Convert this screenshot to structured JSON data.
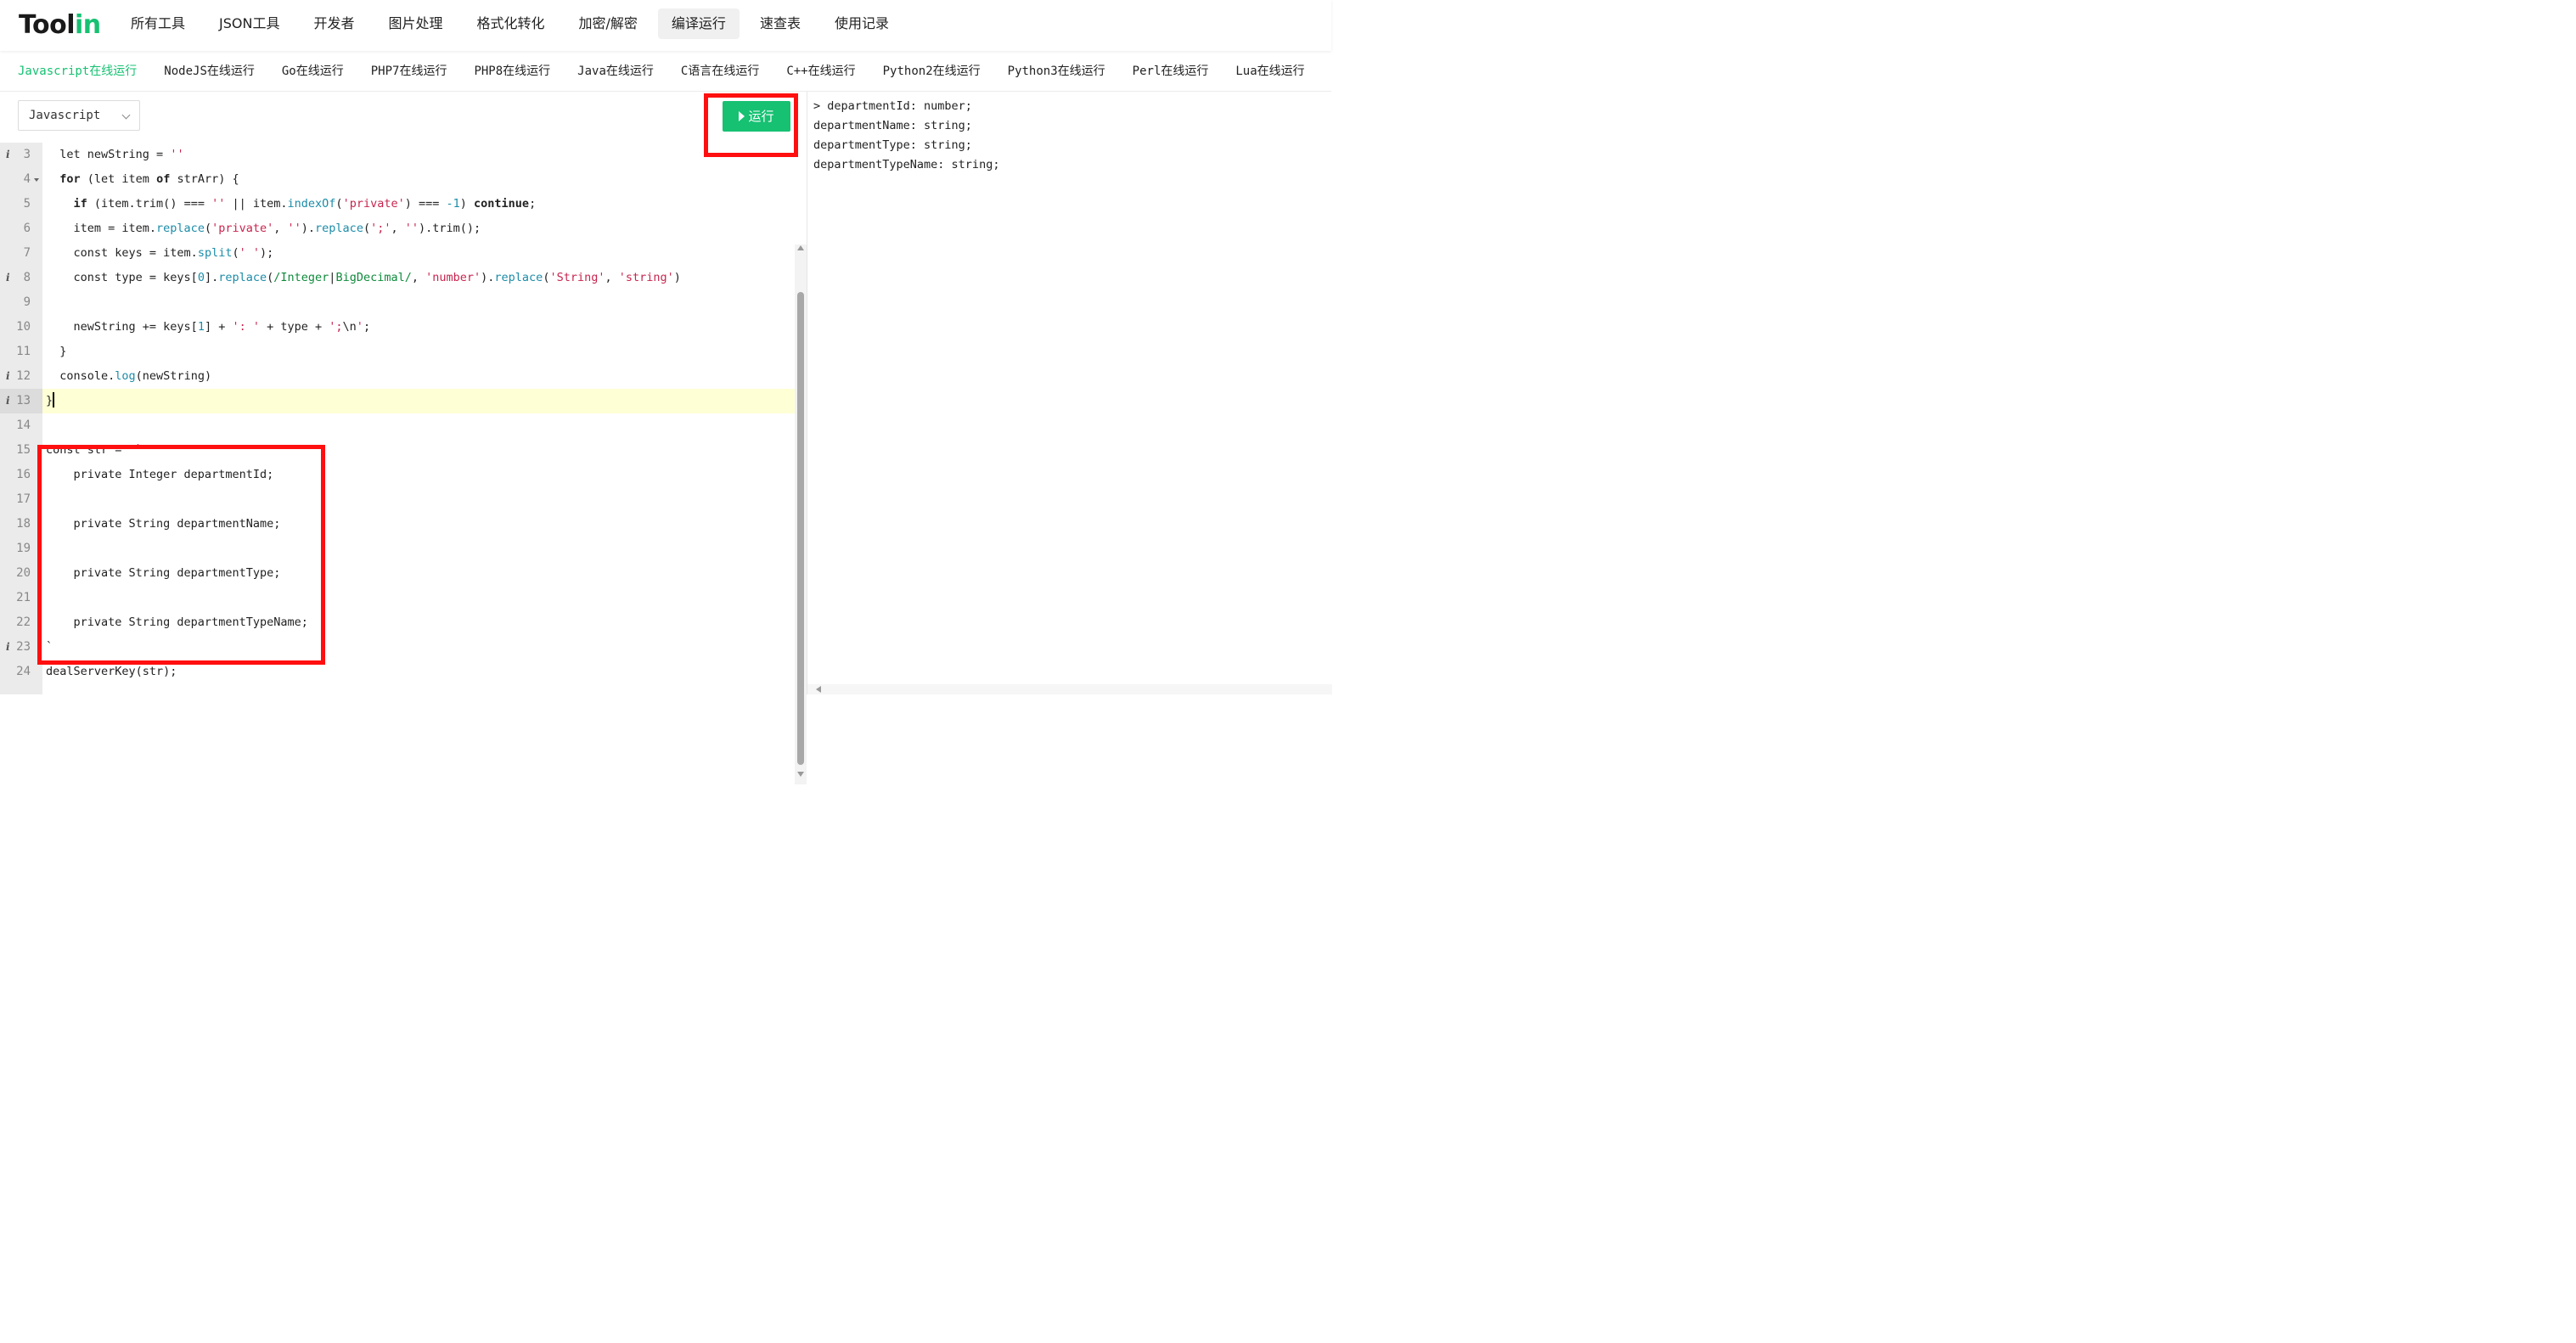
{
  "app": {
    "logo_main": "Tool",
    "logo_accent": "in",
    "accent_color": "#16c172"
  },
  "nav": {
    "items": [
      {
        "label": "所有工具"
      },
      {
        "label": "JSON工具"
      },
      {
        "label": "开发者"
      },
      {
        "label": "图片处理"
      },
      {
        "label": "格式化转化"
      },
      {
        "label": "加密/解密"
      },
      {
        "label": "编译运行",
        "active": true
      },
      {
        "label": "速查表"
      },
      {
        "label": "使用记录"
      }
    ]
  },
  "tabs": {
    "items": [
      {
        "label": "Javascript在线运行",
        "active": true
      },
      {
        "label": "NodeJS在线运行"
      },
      {
        "label": "Go在线运行"
      },
      {
        "label": "PHP7在线运行"
      },
      {
        "label": "PHP8在线运行"
      },
      {
        "label": "Java在线运行"
      },
      {
        "label": "C语言在线运行"
      },
      {
        "label": "C++在线运行"
      },
      {
        "label": "Python2在线运行"
      },
      {
        "label": "Python3在线运行"
      },
      {
        "label": "Perl在线运行"
      },
      {
        "label": "Lua在线运行"
      }
    ]
  },
  "editor": {
    "language_selected": "Javascript",
    "run_label": "运行",
    "lines": [
      {
        "n": "3",
        "info": true
      },
      {
        "n": "4",
        "fold": true
      },
      {
        "n": "5"
      },
      {
        "n": "6"
      },
      {
        "n": "7"
      },
      {
        "n": "8",
        "info": true
      },
      {
        "n": "9"
      },
      {
        "n": "10"
      },
      {
        "n": "11"
      },
      {
        "n": "12",
        "info": true
      },
      {
        "n": "13",
        "info": true,
        "current": true
      },
      {
        "n": "14"
      },
      {
        "n": "15"
      },
      {
        "n": "16"
      },
      {
        "n": "17"
      },
      {
        "n": "18"
      },
      {
        "n": "19"
      },
      {
        "n": "20"
      },
      {
        "n": "21"
      },
      {
        "n": "22"
      },
      {
        "n": "23",
        "info": true
      },
      {
        "n": "24"
      }
    ],
    "code": {
      "l3_a": "  let newString = ",
      "l3_b": "''",
      "l4_a": "  ",
      "l4_for": "for",
      "l4_b": " (let item ",
      "l4_of": "of",
      "l4_c": " strArr) {",
      "l5_a": "    ",
      "l5_if": "if",
      "l5_b": " (item.trim() === ",
      "l5_s1": "''",
      "l5_c": " || item.",
      "l5_fn": "indexOf",
      "l5_d": "(",
      "l5_s2": "'private'",
      "l5_e": ") === ",
      "l5_num": "-1",
      "l5_f": ") ",
      "l5_cont": "continue",
      "l5_g": ";",
      "l6_a": "    item = item.",
      "l6_fn1": "replace",
      "l6_b": "(",
      "l6_s1": "'private'",
      "l6_c": ", ",
      "l6_s2": "''",
      "l6_d": ").",
      "l6_fn2": "replace",
      "l6_e": "(",
      "l6_s3": "';'",
      "l6_f": ", ",
      "l6_s4": "''",
      "l6_g": ").trim();",
      "l7_a": "    const keys = item.",
      "l7_fn": "split",
      "l7_b": "(",
      "l7_s": "' '",
      "l7_c": ");",
      "l8_a": "    const type = keys[",
      "l8_num": "0",
      "l8_b": "].",
      "l8_fn1": "replace",
      "l8_c": "(",
      "l8_re1": "/Integer",
      "l8_pipe": "|",
      "l8_re2": "BigDecimal/",
      "l8_d": ", ",
      "l8_s1": "'number'",
      "l8_e": ").",
      "l8_fn2": "replace",
      "l8_f": "(",
      "l8_s2": "'String'",
      "l8_g": ", ",
      "l8_s3": "'string'",
      "l8_h": ")",
      "l10_a": "    newString += keys[",
      "l10_num": "1",
      "l10_b": "] + ",
      "l10_s1": "': '",
      "l10_c": " + type + ",
      "l10_s2": "';",
      "l10_esc": "\\n",
      "l10_s3": "'",
      "l10_d": ";",
      "l11": "  }",
      "l12_a": "  console.",
      "l12_fn": "log",
      "l12_b": "(newString)",
      "l13": "}",
      "l15_a": "const str =  ",
      "l15_tick": "`",
      "l16": "    private Integer departmentId;",
      "l18": "    private String departmentName;",
      "l20": "    private String departmentType;",
      "l22": "    private String departmentTypeName;",
      "l23": "`",
      "l24": "dealServerKey(str);"
    }
  },
  "output": {
    "lines": [
      "> departmentId: number;",
      "departmentName: string;",
      "departmentType: string;",
      "departmentTypeName: string;"
    ]
  }
}
